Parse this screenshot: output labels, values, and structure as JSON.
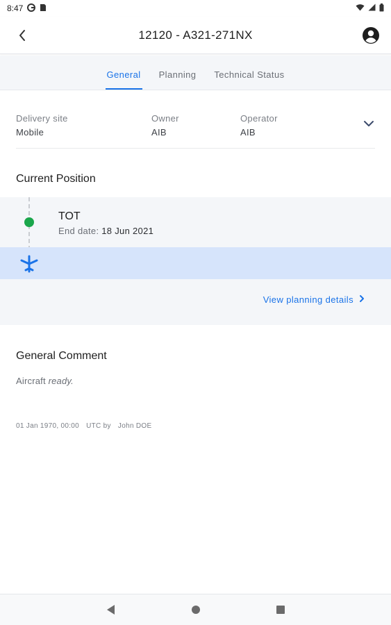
{
  "status_bar": {
    "time": "8:47",
    "icons": [
      "g-icon",
      "sim-icon",
      "wifi-icon",
      "signal-icon",
      "battery-icon"
    ]
  },
  "app_bar": {
    "title": "12120 - A321-271NX",
    "back_icon": "back-arrow-icon",
    "account_icon": "account-circle-icon"
  },
  "tabs": [
    {
      "label": "General",
      "active": true
    },
    {
      "label": "Planning",
      "active": false
    },
    {
      "label": "Technical Status",
      "active": false
    }
  ],
  "info": {
    "delivery_site": {
      "label": "Delivery site",
      "value": "Mobile"
    },
    "owner": {
      "label": "Owner",
      "value": "AIB"
    },
    "operator": {
      "label": "Operator",
      "value": "AIB"
    },
    "expand_icon": "chevron-down-icon"
  },
  "current_position": {
    "title": "Current Position",
    "code": "TOT",
    "end_date_label": "End date:",
    "end_date_value": "18 Jun 2021",
    "status_color": "#1aa64b",
    "flight_icon": "airplane-icon",
    "view_link": "View planning details"
  },
  "general_comment": {
    "title": "General Comment",
    "text_plain": "Aircraft ",
    "text_italic": "ready.",
    "timestamp": "01 Jan 1970, 00:00",
    "timezone_by": "UTC by",
    "author": "John DOE"
  },
  "colors": {
    "accent": "#1a73e8",
    "highlight_row": "#d6e4fb",
    "panel_bg": "#f4f6f9"
  }
}
